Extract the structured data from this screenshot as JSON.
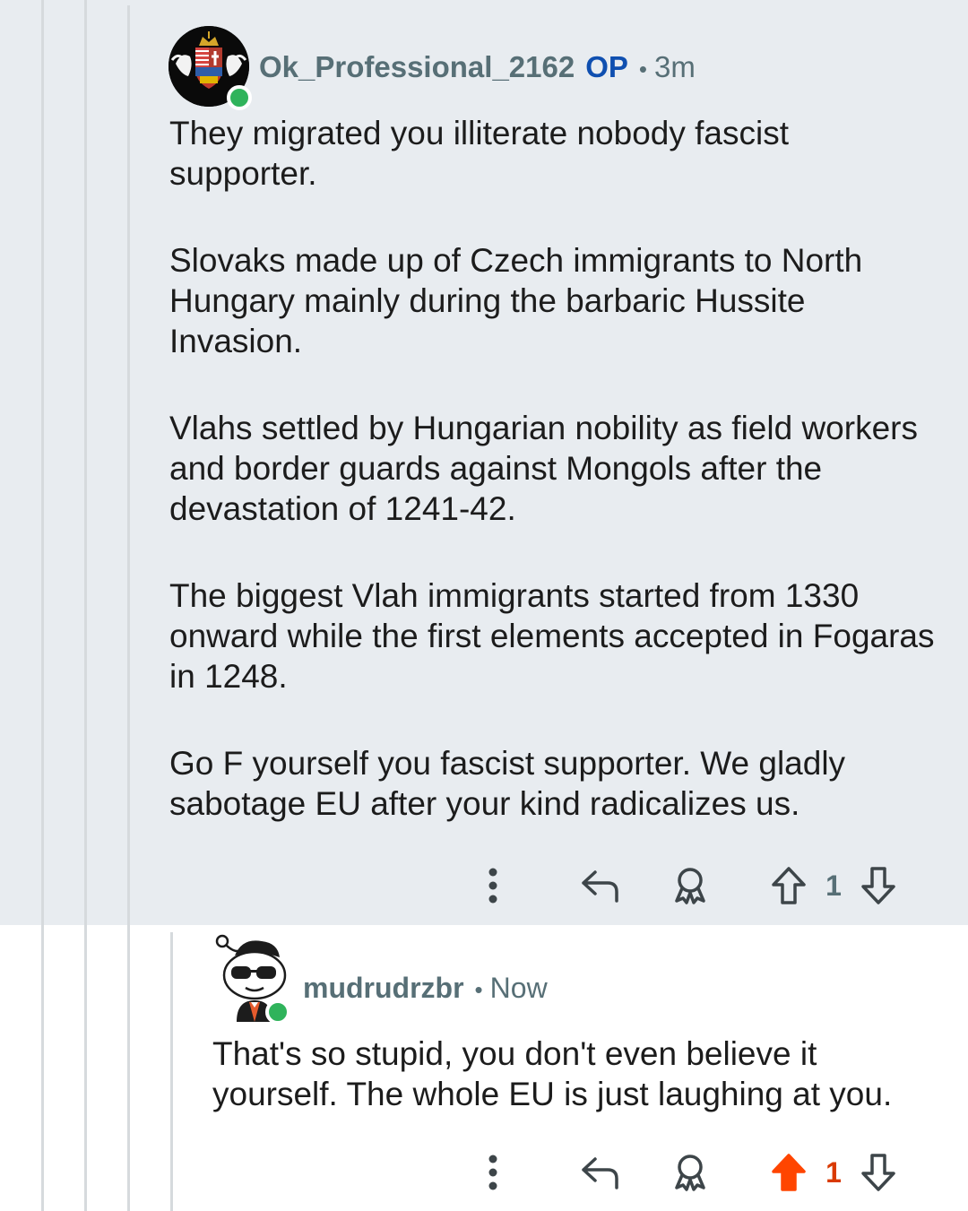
{
  "comments": [
    {
      "username": "Ok_Professional_2162",
      "badge": "OP",
      "separator": "•",
      "time": "3m",
      "paragraphs": [
        "They migrated you illiterate nobody fascist supporter.",
        "Slovaks made up of Czech immigrants to North Hungary mainly during the barbaric Hussite Invasion.",
        "Vlahs settled by Hungarian nobility as field workers and border guards against Mongols after the devastation of 1241-42.",
        "The biggest Vlah immigrants started from 1330 onward while the first elements accepted in Fogaras in 1248.",
        "Go F yourself you fascist supporter. We gladly sabotage EU after your kind radicalizes us."
      ],
      "vote_count": "1",
      "upvoted": false
    },
    {
      "username": "mudrudrzbr",
      "separator": "•",
      "time": "Now",
      "paragraphs": [
        "That's so stupid, you don't even believe it yourself. The whole EU is just laughing at you."
      ],
      "vote_count": "1",
      "upvoted": true
    }
  ],
  "icons": {
    "more": "more-vertical-icon",
    "reply": "reply-arrow-icon",
    "award": "award-icon",
    "upvote": "upvote-arrow-icon",
    "downvote": "downvote-arrow-icon"
  },
  "colors": {
    "highlight_bg": "#e8ecf0",
    "meta_text": "#576f76",
    "op_badge": "#0f4fb0",
    "upvote_active": "#ff4500",
    "online": "#2fb35b"
  }
}
